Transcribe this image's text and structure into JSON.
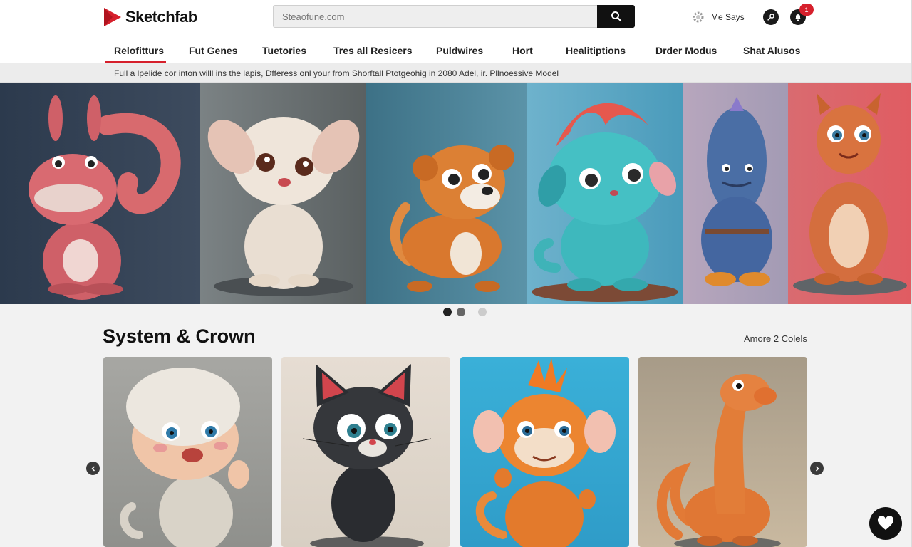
{
  "brand": {
    "name": "Sketchfab",
    "accent": "#d6202c"
  },
  "search": {
    "placeholder": "Steaofune.com"
  },
  "user": {
    "name": "Me Says",
    "notifications": "1"
  },
  "nav": {
    "items": [
      "Relofitturs",
      "Fut Genes",
      "Tuetories",
      "Tres all Resicers",
      "Puldwires",
      "Hort",
      "Healitiptions",
      "Drder Modus",
      "Shat Alusos"
    ],
    "active_index": 0
  },
  "notice": {
    "text": "Full a lpelide cor inton willl ins the lapis, Dfferess onl your from Shorftall Ptotgeohig in 2080 Adel, ir. Pllnoessive Model"
  },
  "hero": {
    "slides": [
      "pink-creature",
      "cream-puppy",
      "orange-monkey",
      "teal-creature",
      "blue-figure",
      "orange-creature"
    ],
    "slide_count": 3,
    "active_slide": 0
  },
  "section": {
    "title": "System & Crown",
    "more_link": "Amore 2 Colels",
    "cards": [
      "baby-in-beanie",
      "black-cat",
      "orange-monkey",
      "orange-dinosaur"
    ]
  },
  "icons": [
    "logo-icon",
    "search-icon",
    "gear-icon",
    "key-icon",
    "bell-icon",
    "chevron-left-icon",
    "chevron-right-icon",
    "heart-icon"
  ]
}
